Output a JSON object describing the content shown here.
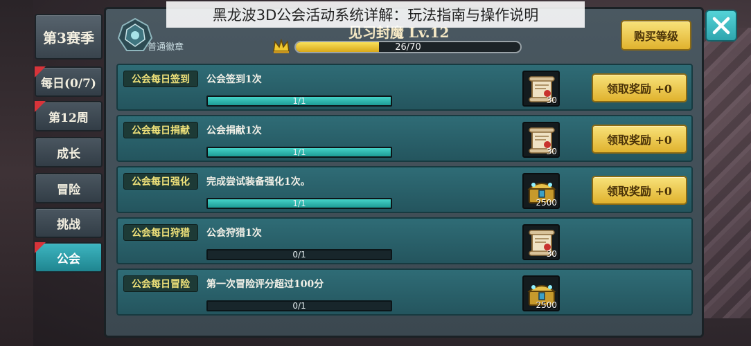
{
  "caption": "黑龙波3D公会活动系统详解：玩法指南与操作说明",
  "sidebar": {
    "season": "第3赛季",
    "items": [
      {
        "label": "每日(0/7)",
        "badge": true,
        "active": false
      },
      {
        "label": "第12周",
        "badge": true,
        "active": false
      },
      {
        "label": "成长",
        "badge": false,
        "active": false
      },
      {
        "label": "冒险",
        "badge": false,
        "active": false
      },
      {
        "label": "挑战",
        "badge": false,
        "active": false
      },
      {
        "label": "公会",
        "badge": true,
        "active": true
      }
    ]
  },
  "header": {
    "emblem_label": "普通徽章",
    "level_title": "见习封魔  Lv.12",
    "xp_text": "26/70",
    "xp_fraction": 0.37,
    "buy_label": "购买等级"
  },
  "tasks": [
    {
      "tag": "公会每日签到",
      "desc": "公会签到1次",
      "progress": "1/1",
      "fraction": 1,
      "reward_icon": "scroll-icon",
      "reward_qty": "30",
      "claim": "领取奖励  +0"
    },
    {
      "tag": "公会每日捐献",
      "desc": "公会捐献1次",
      "progress": "1/1",
      "fraction": 1,
      "reward_icon": "scroll-icon",
      "reward_qty": "30",
      "claim": "领取奖励  +0"
    },
    {
      "tag": "公会每日强化",
      "desc": "完成尝试装备强化1次。",
      "progress": "1/1",
      "fraction": 1,
      "reward_icon": "chest-icon",
      "reward_qty": "2500",
      "claim": "领取奖励  +0"
    },
    {
      "tag": "公会每日狩猎",
      "desc": "公会狩猎1次",
      "progress": "0/1",
      "fraction": 0,
      "reward_icon": "scroll-icon",
      "reward_qty": "30",
      "claim": ""
    },
    {
      "tag": "公会每日冒险",
      "desc": "第一次冒险评分超过100分",
      "progress": "0/1",
      "fraction": 0,
      "reward_icon": "chest-icon",
      "reward_qty": "2500",
      "claim": ""
    }
  ],
  "colors": {
    "accent_teal": "#2ea5ae",
    "gold": "#e0b22e",
    "badge_red": "#d8343a"
  }
}
